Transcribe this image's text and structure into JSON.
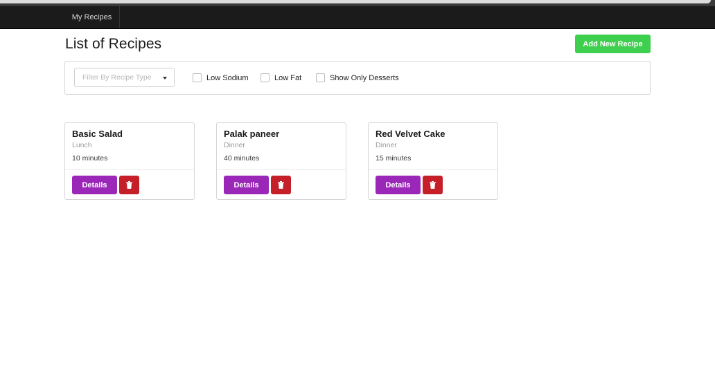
{
  "navbar": {
    "brand": "My Recipes"
  },
  "header": {
    "title": "List of Recipes",
    "add_button_label": "Add New Recipe"
  },
  "filters": {
    "recipe_type_placeholder": "Filter By Recipe Type",
    "checkboxes": [
      {
        "label": "Low Sodium",
        "checked": false
      },
      {
        "label": "Low Fat",
        "checked": false
      },
      {
        "label": "Show Only Desserts",
        "checked": false
      }
    ]
  },
  "recipes": [
    {
      "name": "Basic Salad",
      "type": "Lunch",
      "time": "10 minutes",
      "details_label": "Details",
      "delete_icon": "trash-icon"
    },
    {
      "name": "Palak paneer",
      "type": "Dinner",
      "time": "40 minutes",
      "details_label": "Details",
      "delete_icon": "trash-icon"
    },
    {
      "name": "Red Velvet Cake",
      "type": "Dinner",
      "time": "15 minutes",
      "details_label": "Details",
      "delete_icon": "trash-icon"
    }
  ],
  "colors": {
    "navbar": "#1b1b1b",
    "add_button": "#3fcf4e",
    "details_button": "#9b27b8",
    "delete_button": "#c51f2a"
  }
}
